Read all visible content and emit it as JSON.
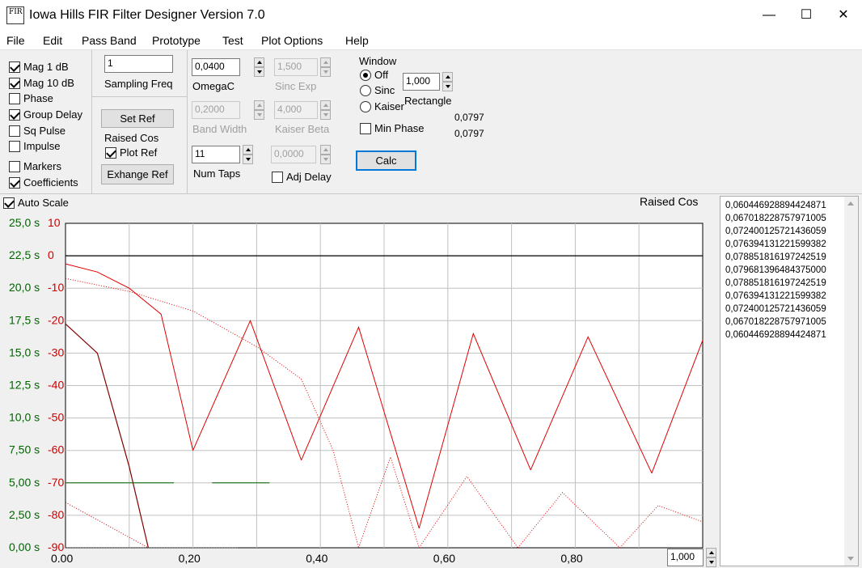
{
  "window": {
    "title": "Iowa Hills FIR Filter Designer  Version 7.0",
    "icon_text": "FIR",
    "minimize_glyph": "—",
    "maximize_glyph": "☐",
    "close_glyph": "✕"
  },
  "menu": [
    "File",
    "Edit",
    "Pass Band",
    "Prototype",
    "Test",
    "Plot Options",
    "Help"
  ],
  "plot_checks": [
    {
      "label": "Mag  1 dB",
      "checked": true
    },
    {
      "label": "Mag 10 dB",
      "checked": true
    },
    {
      "label": "Phase",
      "checked": false
    },
    {
      "label": "Group Delay",
      "checked": true
    },
    {
      "label": "Sq Pulse",
      "checked": false
    },
    {
      "label": "Impulse",
      "checked": false
    },
    {
      "label": "Markers",
      "checked": false
    },
    {
      "label": "Coefficients",
      "checked": true
    }
  ],
  "sampling": {
    "value": "1",
    "label": "Sampling Freq"
  },
  "ref": {
    "set_label": "Set Ref",
    "raised_cos_label": "Raised Cos",
    "plot_ref_label": "Plot Ref",
    "plot_ref_checked": true,
    "exchange_label": "Exhange Ref"
  },
  "params": {
    "omegac": {
      "value": "0,0400",
      "label": "OmegaC"
    },
    "sinc_exp": {
      "value": "1,500",
      "label": "Sinc Exp"
    },
    "band_width": {
      "value": "0,2000",
      "label": "Band Width"
    },
    "kaiser_beta": {
      "value": "4,000",
      "label": "Kaiser Beta"
    },
    "num_taps": {
      "value": "11",
      "label": "Num Taps"
    },
    "adj_delay_value": "0,0000",
    "adj_delay_label": "Adj Delay"
  },
  "window_group": {
    "title": "Window",
    "options": [
      "Off",
      "Sinc",
      "Kaiser"
    ],
    "selected": "Off",
    "value": "1,000",
    "window_type": "Rectangle",
    "min_phase_label": "Min Phase",
    "readout1": "0,0797",
    "readout2": "0,0797",
    "calc_label": "Calc"
  },
  "plot": {
    "auto_scale_label": "Auto Scale",
    "auto_scale_checked": true,
    "ref_title": "Raised Cos",
    "zoom_value": "1,000",
    "colors": {
      "mag": "#ff0000",
      "gd": "#006400",
      "axis_db": "#cc0000",
      "axis_s": "#006400"
    }
  },
  "chart_data": {
    "type": "line",
    "x": [
      0.0,
      0.2,
      0.4,
      0.6,
      0.8
    ],
    "x_tick_labels": [
      "0.00",
      "0,20",
      "0,40",
      "0,60",
      "0,80"
    ],
    "xlim": [
      0,
      1
    ],
    "y_left_labels": [
      "25,0 s",
      "22,5 s",
      "20,0 s",
      "17,5 s",
      "15,0 s",
      "12,5 s",
      "10,0 s",
      "7,50 s",
      "5,00 s",
      "2,50 s",
      "0,00 s"
    ],
    "y_db_labels": [
      "10",
      "0",
      "-10",
      "-20",
      "-30",
      "-40",
      "-50",
      "-60",
      "-70",
      "-80",
      "-90"
    ],
    "ylim_db": [
      -90,
      10
    ],
    "ylim_s": [
      0,
      25
    ],
    "grid": true,
    "series": [
      {
        "x": [
          0,
          0.05,
          0.1,
          0.15,
          0.2
        ],
        "y": [
          -2.5,
          -5,
          -10,
          -18,
          -60
        ]
      },
      {
        "x": [
          0.2,
          0.29,
          0.37
        ],
        "y": [
          -60,
          -20,
          -63
        ]
      },
      {
        "x": [
          0.37,
          0.46,
          0.555
        ],
        "y": [
          -63,
          -22,
          -84
        ]
      },
      {
        "x": [
          0.555,
          0.64,
          0.73
        ],
        "y": [
          -84,
          -24,
          -66
        ]
      },
      {
        "x": [
          0.73,
          0.82,
          0.92
        ],
        "y": [
          -66,
          -25,
          -67
        ]
      },
      {
        "x": [
          0.92,
          1.0
        ],
        "y": [
          -67,
          -26
        ]
      },
      {
        "x": [
          0,
          0.1,
          0.2,
          0.3,
          0.37
        ],
        "y": [
          -7,
          -11,
          -17,
          -28,
          -38
        ]
      },
      {
        "x": [
          0.37,
          0.42,
          0.46
        ],
        "y": [
          -38,
          -60,
          -90
        ]
      },
      {
        "x": [
          0.46,
          0.51,
          0.555
        ],
        "y": [
          -90,
          -62,
          -90
        ]
      },
      {
        "x": [
          0.555,
          0.63,
          0.71
        ],
        "y": [
          -90,
          -68,
          -90
        ]
      },
      {
        "x": [
          0.71,
          0.78,
          0.87
        ],
        "y": [
          -90,
          -73,
          -90
        ]
      },
      {
        "x": [
          0.87,
          0.93,
          1.0
        ],
        "y": [
          -90,
          -77,
          -82
        ]
      },
      {
        "x": [
          0,
          0.05,
          0.1,
          0.13
        ],
        "y": [
          -21,
          -30,
          -65,
          -90
        ]
      },
      {
        "x": [
          0,
          0.13
        ],
        "y": [
          -76,
          -90
        ]
      },
      {
        "x": [
          0,
          0.17
        ],
        "y": [
          5,
          5
        ]
      },
      {
        "x": [
          0.23,
          0.32
        ],
        "y": [
          5,
          5
        ]
      },
      {
        "x": [
          0,
          0.27
        ],
        "y": [
          0,
          0
        ]
      },
      {
        "x": [
          0,
          1
        ],
        "y": [
          22.5,
          22.5
        ]
      }
    ]
  },
  "coefficients": [
    "0,060446928894424871",
    "0,067018228757971005",
    "0,072400125721436059",
    "0,076394131221599382",
    "0,078851816197242519",
    "0,079681396484375000",
    "0,078851816197242519",
    "0,076394131221599382",
    "0,072400125721436059",
    "0,067018228757971005",
    "0,060446928894424871"
  ]
}
